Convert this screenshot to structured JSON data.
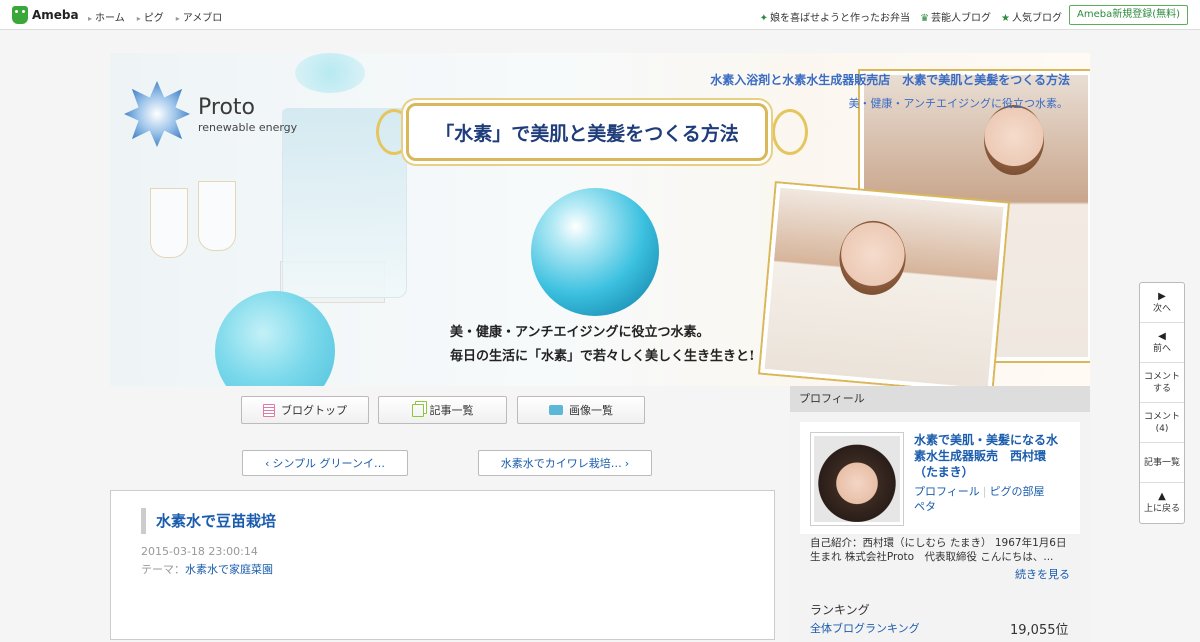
{
  "topbar": {
    "logo_text": "Ameba",
    "nav": [
      "ホーム",
      "ピグ",
      "アメブロ"
    ],
    "links": [
      {
        "label": "娘を喜ばせようと作ったお弁当",
        "icon": "sparkle-icon"
      },
      {
        "label": "芸能人ブログ",
        "icon": "crown-icon"
      },
      {
        "label": "人気ブログ",
        "icon": "star-icon"
      }
    ],
    "signup": "Ameba新規登録(無料)"
  },
  "banner": {
    "brand_name": "Proto",
    "brand_sub": "renewable energy",
    "title_line1": "水素入浴剤と水素水生成器販売店　水素で美肌と美髪をつくる方法",
    "title_line2": "美・健康・アンチエイジングに役立つ水素。",
    "plaque": "「水素」で美肌と美髪をつくる方法",
    "slogan1": "美・健康・アンチエイジングに役立つ水素。",
    "slogan2": "毎日の生活に「水素」で若々しく美しく生き生きと!"
  },
  "buttons": {
    "blog_top": "ブログトップ",
    "article_list": "記事一覧",
    "image_list": "画像一覧"
  },
  "pager": {
    "prev": "シンプル グリーンイ…",
    "next": "水素水でカイワレ栽培…"
  },
  "article": {
    "title": "水素水で豆苗栽培",
    "date": "2015-03-18 23:00:14",
    "theme_label": "テーマ：",
    "theme": "水素水で家庭菜園"
  },
  "sidebar": {
    "heading": "プロフィール",
    "name": "水素で美肌・美髪になる水素水生成器販売　西村環（たまき）",
    "links": [
      "プロフィール",
      "ピグの部屋",
      "ペタ"
    ],
    "intro": "自己紹介：西村環（にしむら たまき） 1967年1月6日生まれ 株式会社Proto　代表取締役 こんにちは、...",
    "more": "続きを見る",
    "ranking_heading": "ランキング",
    "ranking_label": "全体ブログランキング",
    "ranking_value": "19,055位"
  },
  "floatnav": [
    {
      "icon": "play-right-icon",
      "label": "次へ"
    },
    {
      "icon": "play-left-icon",
      "label": "前へ"
    },
    {
      "icon": "",
      "label": "コメントする"
    },
    {
      "icon": "",
      "label": "コメント(4)"
    },
    {
      "icon": "",
      "label": "記事一覧"
    },
    {
      "icon": "triangle-up-icon",
      "label": "上に戻る"
    }
  ],
  "colors": {
    "link": "#1a5cad",
    "ameba_green": "#3aa839",
    "gold": "#d9b85c"
  }
}
